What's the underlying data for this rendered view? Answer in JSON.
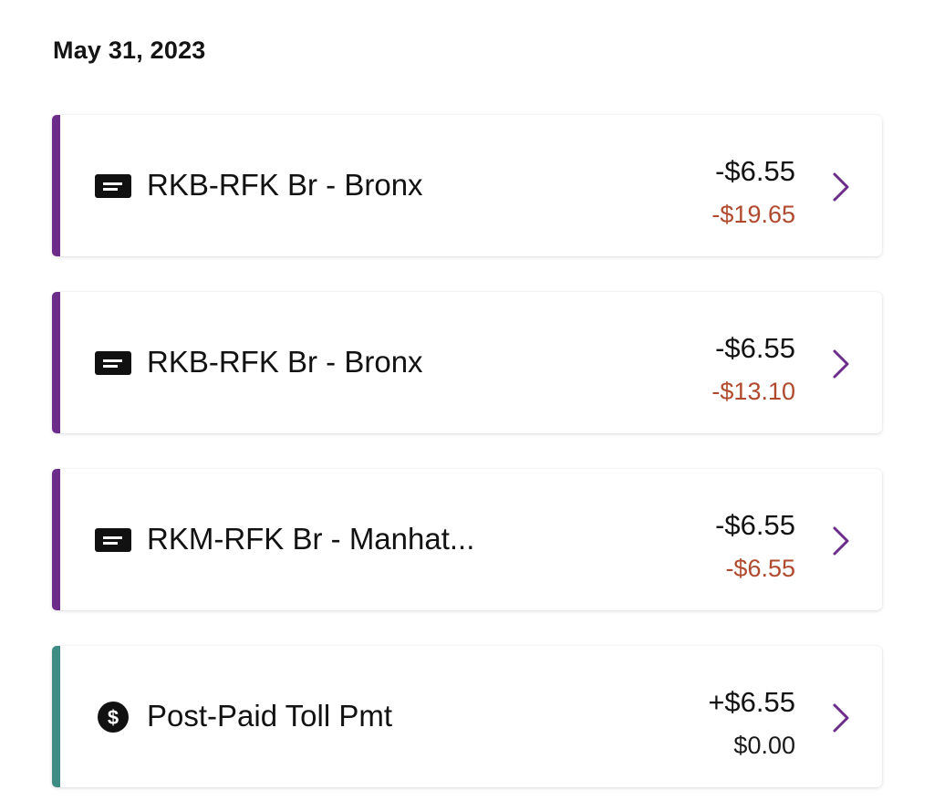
{
  "date_heading": "May 31, 2023",
  "colors": {
    "toll_accent": "#6b2c8a",
    "payment_accent": "#3f8c85",
    "negative_balance": "#b04a2e",
    "chevron": "#6b2c8a"
  },
  "transactions": [
    {
      "icon": "tag-card-icon",
      "title": "RKB-RFK Br - Bronx",
      "amount": "-$6.55",
      "balance": "-$19.65"
    },
    {
      "icon": "tag-card-icon",
      "title": "RKB-RFK Br - Bronx",
      "amount": "-$6.55",
      "balance": "-$13.10"
    },
    {
      "icon": "tag-card-icon",
      "title": "RKM-RFK Br - Manhat...",
      "amount": "-$6.55",
      "balance": "-$6.55"
    },
    {
      "icon": "dollar-circle-icon",
      "title": "Post-Paid Toll Pmt",
      "amount": "+$6.55",
      "balance": "$0.00"
    }
  ]
}
